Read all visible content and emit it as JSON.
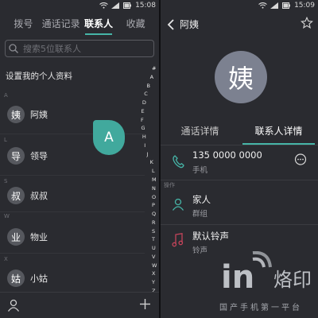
{
  "left": {
    "status_time": "15:08",
    "tabs": [
      {
        "label": "拨号"
      },
      {
        "label": "通话记录"
      },
      {
        "label": "联系人"
      },
      {
        "label": "收藏"
      }
    ],
    "active_tab": "联系人",
    "search_placeholder": "搜索5位联系人",
    "my_profile": "设置我的个人资料",
    "sections": [
      {
        "letter": "A",
        "name": "阿姨",
        "avatar": "姨"
      },
      {
        "letter": "L",
        "name": "领导",
        "avatar": "导"
      },
      {
        "letter": "S",
        "name": "叔叔",
        "avatar": "叔"
      },
      {
        "letter": "W",
        "name": "物业",
        "avatar": "业"
      },
      {
        "letter": "X",
        "name": "小姑",
        "avatar": "姑"
      }
    ],
    "bubble_letter": "A",
    "index_letters": [
      "#",
      "A",
      "B",
      "C",
      "D",
      "E",
      "F",
      "G",
      "H",
      "I",
      "J",
      "K",
      "L",
      "M",
      "N",
      "O",
      "P",
      "Q",
      "R",
      "S",
      "T",
      "U",
      "V",
      "W",
      "X",
      "Y",
      "Z"
    ],
    "icons": {
      "profile": "person-icon",
      "add": "plus-icon"
    }
  },
  "right": {
    "status_time": "15:09",
    "contact_name": "阿姨",
    "avatar_char": "姨",
    "tabs": [
      {
        "label": "通话详情"
      },
      {
        "label": "联系人详情"
      }
    ],
    "active_tab": "联系人详情",
    "phone": {
      "number": "135 0000 0000",
      "type": "手机"
    },
    "operations_label": "操作",
    "group": {
      "name": "家人",
      "label": "群组"
    },
    "ringtone": {
      "name": "默认铃声",
      "label": "铃声"
    },
    "watermark": {
      "brand": "in",
      "brand_cn": "烙印",
      "slogan": "国产手机第一平台"
    }
  },
  "colors": {
    "accent": "#46b5a7",
    "background": "#2a2b30",
    "ringtone_icon": "#c2445a"
  }
}
